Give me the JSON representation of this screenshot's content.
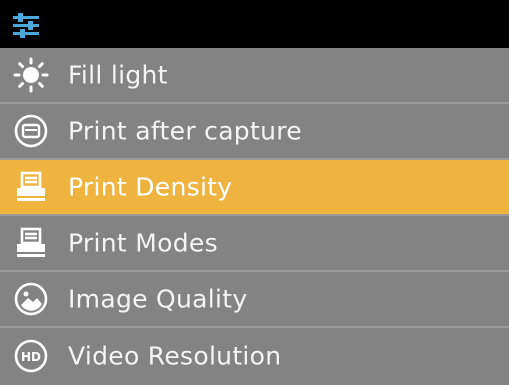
{
  "topbar": {
    "icon": "settings-sliders-icon"
  },
  "menu": {
    "items": [
      {
        "label": "Fill light",
        "icon": "sun-icon",
        "selected": false
      },
      {
        "label": "Print after capture",
        "icon": "print-after-capture-icon",
        "selected": false
      },
      {
        "label": "Print Density",
        "icon": "printer-icon",
        "selected": true
      },
      {
        "label": "Print Modes",
        "icon": "printer-icon",
        "selected": false
      },
      {
        "label": "Image Quality",
        "icon": "image-quality-icon",
        "selected": false
      },
      {
        "label": "Video Resolution",
        "icon": "hd-icon",
        "selected": false
      }
    ]
  },
  "colors": {
    "background": "#838383",
    "topbar": "#000000",
    "accent": "#efb43f",
    "text": "#f4f4f4",
    "icon_topbar": "#4aa9d8"
  }
}
